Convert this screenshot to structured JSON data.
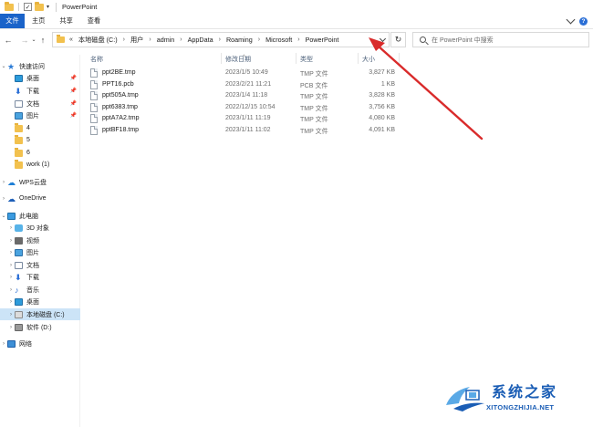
{
  "window": {
    "title": "PowerPoint"
  },
  "ribbon": {
    "tabs": [
      "文件",
      "主页",
      "共享",
      "查看"
    ]
  },
  "address": {
    "crumbs": [
      "本地磁盘 (C:)",
      "用户",
      "admin",
      "AppData",
      "Roaming",
      "Microsoft",
      "PowerPoint"
    ],
    "overflow": "«",
    "separator": "›"
  },
  "search": {
    "placeholder": "在 PowerPoint 中搜索"
  },
  "sidebar": {
    "items": [
      {
        "label": "快速访问",
        "icon": "star-icon"
      },
      {
        "label": "桌面",
        "icon": "desktop-icon",
        "pinned": true
      },
      {
        "label": "下载",
        "icon": "download-icon",
        "pinned": true
      },
      {
        "label": "文档",
        "icon": "document-icon",
        "pinned": true
      },
      {
        "label": "图片",
        "icon": "picture-icon",
        "pinned": true
      },
      {
        "label": "4",
        "icon": "folder-icon"
      },
      {
        "label": "5",
        "icon": "folder-icon"
      },
      {
        "label": "6",
        "icon": "folder-icon"
      },
      {
        "label": "work (1)",
        "icon": "folder-icon"
      },
      {
        "label": "WPS云盘",
        "icon": "cloud-icon"
      },
      {
        "label": "OneDrive",
        "icon": "onedrive-icon"
      },
      {
        "label": "此电脑",
        "icon": "computer-icon"
      },
      {
        "label": "3D 对象",
        "icon": "3d-objects-icon"
      },
      {
        "label": "视频",
        "icon": "video-icon"
      },
      {
        "label": "图片",
        "icon": "picture-icon"
      },
      {
        "label": "文档",
        "icon": "document-icon"
      },
      {
        "label": "下载",
        "icon": "download-icon"
      },
      {
        "label": "音乐",
        "icon": "music-icon"
      },
      {
        "label": "桌面",
        "icon": "desktop-icon"
      },
      {
        "label": "本地磁盘 (C:)",
        "icon": "drive-icon",
        "selected": true
      },
      {
        "label": "软件 (D:)",
        "icon": "drive-icon"
      },
      {
        "label": "网络",
        "icon": "network-icon"
      }
    ]
  },
  "filelist": {
    "columns": {
      "name": "名称",
      "date": "修改日期",
      "type": "类型",
      "size": "大小"
    },
    "rows": [
      {
        "name": "ppt2BE.tmp",
        "date": "2023/1/5 10:49",
        "type": "TMP 文件",
        "size": "3,827 KB"
      },
      {
        "name": "PPT16.pcb",
        "date": "2023/2/21 11:21",
        "type": "PCB 文件",
        "size": "1 KB"
      },
      {
        "name": "ppt505A.tmp",
        "date": "2023/1/4 11:18",
        "type": "TMP 文件",
        "size": "3,828 KB"
      },
      {
        "name": "ppt6383.tmp",
        "date": "2022/12/15 10:54",
        "type": "TMP 文件",
        "size": "3,756 KB"
      },
      {
        "name": "pptA7A2.tmp",
        "date": "2023/1/11 11:19",
        "type": "TMP 文件",
        "size": "4,080 KB"
      },
      {
        "name": "pptBF18.tmp",
        "date": "2023/1/11 11:02",
        "type": "TMP 文件",
        "size": "4,091 KB"
      }
    ]
  },
  "watermark": {
    "title": "系统之家",
    "url": "XITONGZHIJIA.NET"
  },
  "colors": {
    "accent": "#1a63c9",
    "selected": "#cce4f7",
    "annotation": "#d92b2b"
  }
}
